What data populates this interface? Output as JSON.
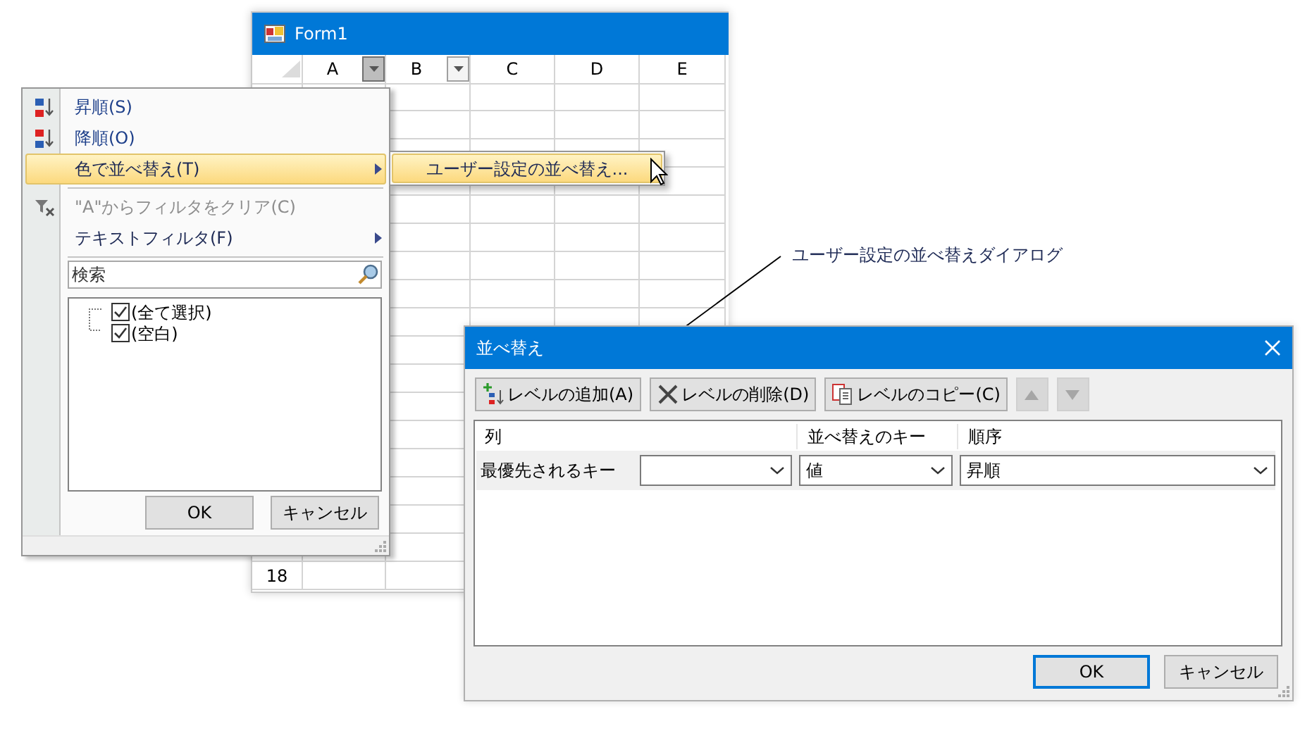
{
  "form_window": {
    "title": "Form1",
    "columns": [
      {
        "label": "A",
        "filter_button": true,
        "pressed": true
      },
      {
        "label": "B",
        "filter_button": true,
        "pressed": false
      },
      {
        "label": "C",
        "filter_button": false
      },
      {
        "label": "D",
        "filter_button": false
      },
      {
        "label": "E",
        "filter_button": false
      }
    ],
    "row_header": "18"
  },
  "filter_menu": {
    "items": [
      {
        "kind": "ascending",
        "label": "昇順(S)",
        "selected": false,
        "disabled": false,
        "submenu": false
      },
      {
        "kind": "descending",
        "label": "降順(O)",
        "selected": false,
        "disabled": false,
        "submenu": false
      },
      {
        "kind": "plain",
        "label": "色で並べ替え(T)",
        "selected": true,
        "disabled": false,
        "submenu": true
      },
      {
        "kind": "separator"
      },
      {
        "kind": "clear-filter",
        "label": "\"A\"からフィルタをクリア(C)",
        "selected": false,
        "disabled": true,
        "submenu": false
      },
      {
        "kind": "plain",
        "label": "テキストフィルタ(F)",
        "selected": false,
        "disabled": false,
        "submenu": true
      },
      {
        "kind": "separator"
      }
    ],
    "search": {
      "placeholder": "検索"
    },
    "values": [
      {
        "label": "(全て選択)",
        "checked": true
      },
      {
        "label": "(空白)",
        "checked": true
      }
    ],
    "buttons": [
      {
        "label": "OK"
      },
      {
        "label": "キャンセル"
      }
    ]
  },
  "submenu": {
    "items": [
      {
        "label": "ユーザー設定の並べ替え...",
        "selected": true
      }
    ]
  },
  "annotation": {
    "text": "ユーザー設定の並べ替えダイアログ"
  },
  "sort_dialog": {
    "title": "並べ替え",
    "toolbar": [
      {
        "kind": "add",
        "label": "レベルの追加(A)",
        "disabled": false
      },
      {
        "kind": "delete",
        "label": "レベルの削除(D)",
        "disabled": false
      },
      {
        "kind": "copy",
        "label": "レベルのコピー(C)",
        "disabled": false
      },
      {
        "kind": "up",
        "disabled": true
      },
      {
        "kind": "down",
        "disabled": true
      }
    ],
    "columns": [
      "列",
      "並べ替えのキー",
      "順序"
    ],
    "rows": [
      {
        "label": "最優先されるキー",
        "sort_on": "値",
        "order": "昇順"
      }
    ],
    "buttons": [
      {
        "label": "OK",
        "default": true
      },
      {
        "label": "キャンセル",
        "default": false
      }
    ]
  }
}
